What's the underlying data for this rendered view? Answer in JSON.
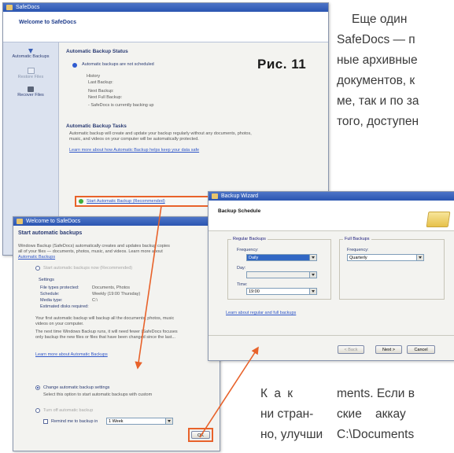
{
  "article": {
    "right_top_lines": [
      "Еще один",
      "SafeDocs — п",
      "ные архивные",
      "документов, к",
      "ме, так и по за",
      "того, доступен"
    ],
    "figure_caption": "Рис. 11",
    "col_left_lines": [
      "К а к",
      "ни стран-",
      "но, улучши-"
    ],
    "col_right_lines": [
      "ments. Если в",
      "ские    аккау",
      "C:\\Documents"
    ]
  },
  "window_main": {
    "title": "SafeDocs",
    "header": "Welcome to SafeDocs",
    "sidebar": [
      {
        "label": "Automatic Backups",
        "icon": "download-arrow-icon"
      },
      {
        "label": "Restore Files",
        "icon": "restore-icon"
      },
      {
        "label": "Recover Files",
        "icon": "recover-disk-icon"
      }
    ],
    "status_title": "Automatic Backup Status",
    "status_line": "Automatic backups are not scheduled",
    "history_lines": [
      "History",
      "Last Backup:",
      "Next Backup:",
      "Next Full Backup:",
      "- SafeDocs is currently backing up"
    ],
    "tasks_title": "Automatic Backup Tasks",
    "tasks_text": [
      "Automatic backup will create and update your backup regularly without any documents, photos,",
      "music, and videos on your computer will be automatically protected."
    ],
    "tasks_link": "Learn more about how Automatic Backup helps keep your data safe",
    "start_button": "Start Automatic Backup (Recommended)"
  },
  "window_start": {
    "title": "Welcome to SafeDocs",
    "header": "Start automatic backups",
    "intro": [
      "Windows Backup (SafeDocs) automatically creates and updates backup copies",
      "all of your files — documents, photos, music, and videos. Learn more about",
      "Automatic Backups"
    ],
    "opt_start_label": "Start automatic backups now (Recommended)",
    "settings_title": "Settings",
    "settings_rows": [
      {
        "label": "File types protected:",
        "value": "Documents, Photos"
      },
      {
        "label": "Schedule:",
        "value": "Weekly (19:00 Thursday)"
      },
      {
        "label": "Media type:",
        "value": "C:\\"
      },
      {
        "label": "Estimated disks required:",
        "value": ""
      }
    ],
    "note_1": [
      "Your first automatic backup will backup all the documents, photos, music",
      "videos on your computer."
    ],
    "note_2": [
      "The next time Windows Backup runs, it will need fewer (SafeDocs focuses",
      "only backup the new files or files that have been changed since the last..."
    ],
    "learn_link": "Learn more about Automatic Backups",
    "opt_change_label": "Change automatic backup settings",
    "opt_change_desc": "Select this option to start automatic backups with custom",
    "opt_turnoff_label": "Turn off automatic backup",
    "remind_label": "Remind me to backup in",
    "remind_value": "1 Week",
    "ok_button": "OK"
  },
  "window_wizard": {
    "title": "Backup Wizard",
    "header": "Backup Schedule",
    "regular_group": "Regular Backups",
    "frequency_label": "Frequency:",
    "frequency_value": "Daily",
    "day_label": "Day:",
    "day_value": "",
    "time_label": "Time:",
    "time_value": "19:00",
    "full_group": "Full Backups",
    "full_frequency_label": "Frequency:",
    "full_frequency_value": "Quarterly",
    "learn_link": "Learn about regular and full backups",
    "back_button": "< Back",
    "next_button": "Next >",
    "cancel_button": "Cancel"
  },
  "colors": {
    "arrow": "#e8622a",
    "start_button_border": "#e8622a",
    "title_bar": "#2a55b1"
  }
}
